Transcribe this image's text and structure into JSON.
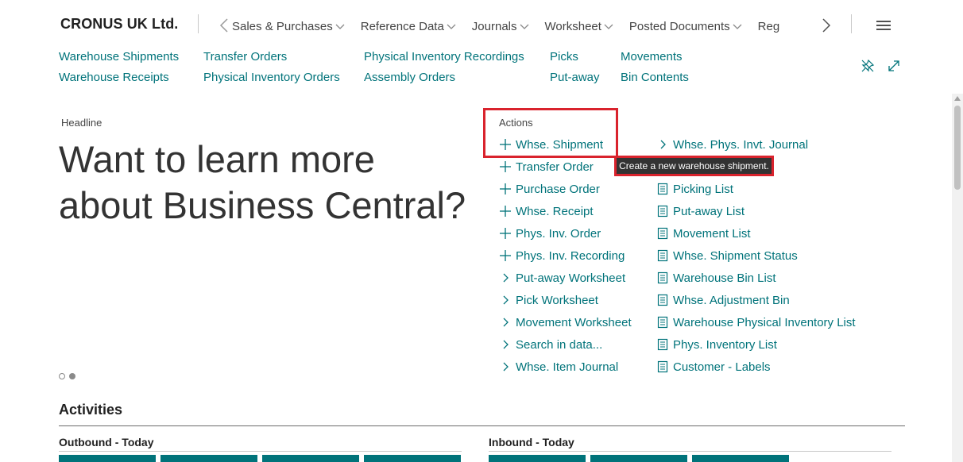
{
  "header": {
    "company": "CRONUS UK Ltd.",
    "nav": [
      {
        "label": "Sales & Purchases"
      },
      {
        "label": "Reference Data"
      },
      {
        "label": "Journals"
      },
      {
        "label": "Worksheet"
      },
      {
        "label": "Posted Documents"
      },
      {
        "label": "Reg"
      }
    ]
  },
  "sublinks": {
    "warehouse_shipments": "Warehouse Shipments",
    "warehouse_receipts": "Warehouse Receipts",
    "transfer_orders": "Transfer Orders",
    "physical_inventory_orders": "Physical Inventory Orders",
    "physical_inventory_recordings": "Physical Inventory Recordings",
    "assembly_orders": "Assembly Orders",
    "picks": "Picks",
    "put_away": "Put-away",
    "movements": "Movements",
    "bin_contents": "Bin Contents"
  },
  "headline": {
    "label": "Headline",
    "text": "Want to learn more about Business Central?"
  },
  "actions": {
    "label": "Actions",
    "col1": [
      {
        "label": "Whse. Shipment",
        "icon": "plus-icon"
      },
      {
        "label": "Transfer Order",
        "icon": "plus-icon"
      },
      {
        "label": "Purchase Order",
        "icon": "plus-icon"
      },
      {
        "label": "Whse. Receipt",
        "icon": "plus-icon"
      },
      {
        "label": "Phys. Inv. Order",
        "icon": "plus-icon"
      },
      {
        "label": "Phys. Inv. Recording",
        "icon": "plus-icon"
      },
      {
        "label": "Put-away Worksheet",
        "icon": "chevron-right-icon"
      },
      {
        "label": "Pick Worksheet",
        "icon": "chevron-right-icon"
      },
      {
        "label": "Movement Worksheet",
        "icon": "chevron-right-icon"
      },
      {
        "label": "Search in data...",
        "icon": "chevron-right-icon"
      },
      {
        "label": "Whse. Item Journal",
        "icon": "chevron-right-icon"
      }
    ],
    "col2": [
      {
        "label": "Whse. Phys. Invt. Journal",
        "icon": "chevron-right-icon"
      },
      {
        "label": "Picking List",
        "icon": "report-icon"
      },
      {
        "label": "Put-away List",
        "icon": "report-icon"
      },
      {
        "label": "Movement List",
        "icon": "report-icon"
      },
      {
        "label": "Whse. Shipment Status",
        "icon": "report-icon"
      },
      {
        "label": "Warehouse Bin List",
        "icon": "report-icon"
      },
      {
        "label": "Whse. Adjustment Bin",
        "icon": "report-icon"
      },
      {
        "label": "Warehouse Physical Inventory List",
        "icon": "report-icon"
      },
      {
        "label": "Phys. Inventory List",
        "icon": "report-icon"
      },
      {
        "label": "Customer - Labels",
        "icon": "report-icon"
      }
    ],
    "tooltip": "Create a new warehouse shipment."
  },
  "activities": {
    "title": "Activities",
    "outbound_label": "Outbound - Today",
    "inbound_label": "Inbound - Today"
  },
  "colors": {
    "accent": "#00737a",
    "highlight": "#d9232d",
    "tile": "#00737a"
  }
}
